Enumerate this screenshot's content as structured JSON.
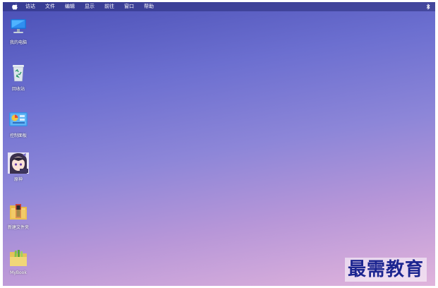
{
  "menubar": {
    "items": [
      "访达",
      "文件",
      "编辑",
      "显示",
      "前往",
      "窗口",
      "帮助"
    ]
  },
  "desktop_icons": [
    {
      "label": "我的电脑",
      "icon": "computer-icon"
    },
    {
      "label": "回收站",
      "icon": "recycle-bin-icon"
    },
    {
      "label": "控制面板",
      "icon": "control-panel-icon"
    },
    {
      "label": "原神",
      "icon": "game-shortcut-icon"
    },
    {
      "label": "新建文件夹",
      "icon": "folder-icon"
    },
    {
      "label": "MyBook",
      "icon": "mybook-folder-icon"
    }
  ],
  "watermark": "最需教育",
  "colors": {
    "desktop_top": "#4a4fb5",
    "desktop_bottom": "#e0b4dc",
    "watermark": "#1c2590"
  }
}
